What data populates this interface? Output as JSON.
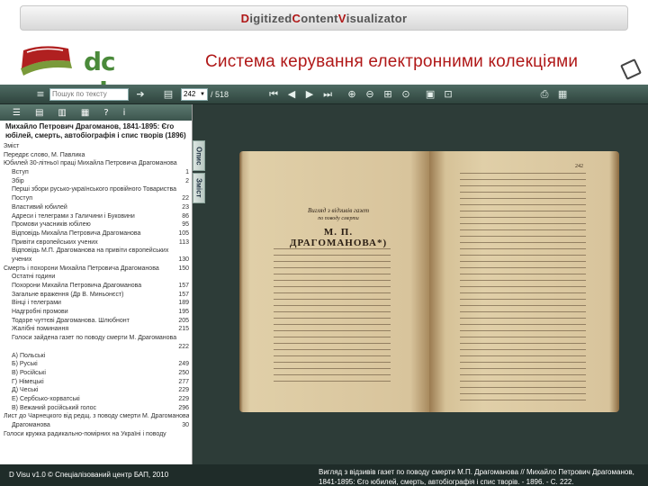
{
  "banner": {
    "p1_hl": "D",
    "p1": "igitized ",
    "p2_hl": "C",
    "p2": "ontent ",
    "p3_hl": "V",
    "p3": "isualizator"
  },
  "header": {
    "logo": "dc visu",
    "title": "Система керування електронними колекціями"
  },
  "toolbar": {
    "search_placeholder": "Пошук по тексту",
    "page_value": "242",
    "page_total": "/ 518",
    "icons": [
      "menu-icon",
      "arrow-right-icon",
      "page-icon",
      "first-page-icon",
      "prev-page-icon",
      "next-page-icon",
      "last-page-icon",
      "zoom-in-icon",
      "zoom-out-icon",
      "fit-icon",
      "rotate-icon",
      "image-icon",
      "zoom-fit-icon",
      "print-icon",
      "save-icon"
    ]
  },
  "left_panel": {
    "title": "Михайло Петрович Драгоманов, 1841-1895: Єго юбілей, смерть, автобіографія і спис творів (1896)",
    "tabs": [
      "Опис",
      "Зміст"
    ],
    "toc": [
      {
        "t": "Зміст",
        "p": "",
        "i": false
      },
      {
        "t": "Передрє слово, М. Павлика",
        "p": "",
        "i": false
      },
      {
        "t": "Юбилей 30-літньої праці Михайла Петровича Драгоманова",
        "p": "",
        "i": false
      },
      {
        "t": "Вступ",
        "p": "1",
        "i": true
      },
      {
        "t": "Збір",
        "p": "2",
        "i": true
      },
      {
        "t": "Перші збори русько-українського провійного Товариства",
        "p": "",
        "i": true
      },
      {
        "t": "Поступ",
        "p": "22",
        "i": true
      },
      {
        "t": "Властивий юбилей",
        "p": "23",
        "i": true
      },
      {
        "t": "Адреси і телеграми з Галичини і Буковини",
        "p": "86",
        "i": true
      },
      {
        "t": "Промови учасників юбілею",
        "p": "95",
        "i": true
      },
      {
        "t": "Відповідь Михайла Петровича Драгоманова",
        "p": "105",
        "i": true
      },
      {
        "t": "Привіти європейських учених",
        "p": "113",
        "i": true
      },
      {
        "t": "Відповідь М.П. Драгоманова на привіти європейських",
        "p": "",
        "i": true
      },
      {
        "t": "учених",
        "p": "130",
        "i": true
      },
      {
        "t": "Смерть і похорони Михайла Петровича Драгоманова",
        "p": "150",
        "i": false
      },
      {
        "t": "Остатні години",
        "p": "",
        "i": true
      },
      {
        "t": "Похорони Михайла Петровича Драгоманова",
        "p": "157",
        "i": true
      },
      {
        "t": "Загальне враження (Др В. Миньонєст)",
        "p": "157",
        "i": true
      },
      {
        "t": "Вінці і телеграми",
        "p": "189",
        "i": true
      },
      {
        "t": "Надгробні промови",
        "p": "195",
        "i": true
      },
      {
        "t": "Тодоре чуттєві Драгоманова. Шлюбнонт",
        "p": "205",
        "i": true
      },
      {
        "t": "Жалібні поминання",
        "p": "215",
        "i": true
      },
      {
        "t": "Голоси зайдена газет по поводу смерти М. Драгоманова",
        "p": "",
        "i": true
      },
      {
        "t": "",
        "p": "222",
        "i": true
      },
      {
        "t": "А) Польські",
        "p": "",
        "i": true
      },
      {
        "t": "Б) Руські",
        "p": "249",
        "i": true
      },
      {
        "t": "В) Російські",
        "p": "250",
        "i": true
      },
      {
        "t": "Г) Німецькі",
        "p": "277",
        "i": true
      },
      {
        "t": "Д) Чеські",
        "p": "229",
        "i": true
      },
      {
        "t": "Е) Сербсько-хорватські",
        "p": "229",
        "i": true
      },
      {
        "t": "В) Вежаний російський голос",
        "p": "296",
        "i": true
      },
      {
        "t": "Лист до Чарнецкого від редщ. з поводу смерти М. Драгоманова",
        "p": "",
        "i": false
      },
      {
        "t": "Драгоманова",
        "p": "30",
        "i": true
      },
      {
        "t": "Голоси кружка радикально-помірних на Україні і поводу",
        "p": "",
        "i": false
      }
    ]
  },
  "book": {
    "left_head_a": "Вигляд з відзивів газет",
    "left_head_b": "по поводу смерти",
    "left_head_c": "М. П. ДРАГОМАНОВА*)",
    "right_page_num": "242"
  },
  "footer": {
    "left": "D Visu v1.0 © Спеціалізований центр БАП, 2010",
    "right": "Вигляд з відзивів газет по поводу смерти М.П. Драгоманова // Михайло Петрович Драгоманов, 1841-1895: Єго юбилей, смерть, автобіографія і спис творів. - 1896. - С. 222."
  }
}
